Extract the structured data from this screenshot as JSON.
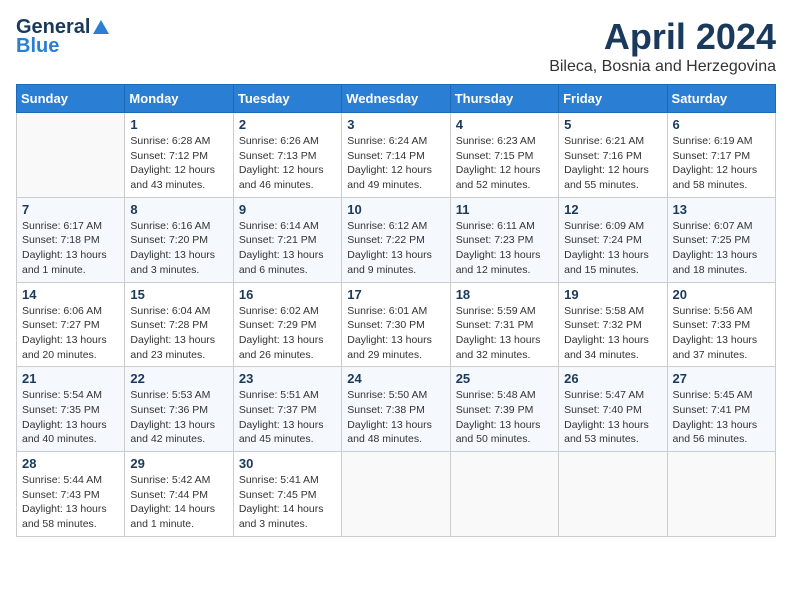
{
  "logo": {
    "general": "General",
    "blue": "Blue"
  },
  "header": {
    "month": "April 2024",
    "location": "Bileca, Bosnia and Herzegovina"
  },
  "days_of_week": [
    "Sunday",
    "Monday",
    "Tuesday",
    "Wednesday",
    "Thursday",
    "Friday",
    "Saturday"
  ],
  "weeks": [
    [
      {
        "day": "",
        "sunrise": "",
        "sunset": "",
        "daylight": ""
      },
      {
        "day": "1",
        "sunrise": "Sunrise: 6:28 AM",
        "sunset": "Sunset: 7:12 PM",
        "daylight": "Daylight: 12 hours and 43 minutes."
      },
      {
        "day": "2",
        "sunrise": "Sunrise: 6:26 AM",
        "sunset": "Sunset: 7:13 PM",
        "daylight": "Daylight: 12 hours and 46 minutes."
      },
      {
        "day": "3",
        "sunrise": "Sunrise: 6:24 AM",
        "sunset": "Sunset: 7:14 PM",
        "daylight": "Daylight: 12 hours and 49 minutes."
      },
      {
        "day": "4",
        "sunrise": "Sunrise: 6:23 AM",
        "sunset": "Sunset: 7:15 PM",
        "daylight": "Daylight: 12 hours and 52 minutes."
      },
      {
        "day": "5",
        "sunrise": "Sunrise: 6:21 AM",
        "sunset": "Sunset: 7:16 PM",
        "daylight": "Daylight: 12 hours and 55 minutes."
      },
      {
        "day": "6",
        "sunrise": "Sunrise: 6:19 AM",
        "sunset": "Sunset: 7:17 PM",
        "daylight": "Daylight: 12 hours and 58 minutes."
      }
    ],
    [
      {
        "day": "7",
        "sunrise": "Sunrise: 6:17 AM",
        "sunset": "Sunset: 7:18 PM",
        "daylight": "Daylight: 13 hours and 1 minute."
      },
      {
        "day": "8",
        "sunrise": "Sunrise: 6:16 AM",
        "sunset": "Sunset: 7:20 PM",
        "daylight": "Daylight: 13 hours and 3 minutes."
      },
      {
        "day": "9",
        "sunrise": "Sunrise: 6:14 AM",
        "sunset": "Sunset: 7:21 PM",
        "daylight": "Daylight: 13 hours and 6 minutes."
      },
      {
        "day": "10",
        "sunrise": "Sunrise: 6:12 AM",
        "sunset": "Sunset: 7:22 PM",
        "daylight": "Daylight: 13 hours and 9 minutes."
      },
      {
        "day": "11",
        "sunrise": "Sunrise: 6:11 AM",
        "sunset": "Sunset: 7:23 PM",
        "daylight": "Daylight: 13 hours and 12 minutes."
      },
      {
        "day": "12",
        "sunrise": "Sunrise: 6:09 AM",
        "sunset": "Sunset: 7:24 PM",
        "daylight": "Daylight: 13 hours and 15 minutes."
      },
      {
        "day": "13",
        "sunrise": "Sunrise: 6:07 AM",
        "sunset": "Sunset: 7:25 PM",
        "daylight": "Daylight: 13 hours and 18 minutes."
      }
    ],
    [
      {
        "day": "14",
        "sunrise": "Sunrise: 6:06 AM",
        "sunset": "Sunset: 7:27 PM",
        "daylight": "Daylight: 13 hours and 20 minutes."
      },
      {
        "day": "15",
        "sunrise": "Sunrise: 6:04 AM",
        "sunset": "Sunset: 7:28 PM",
        "daylight": "Daylight: 13 hours and 23 minutes."
      },
      {
        "day": "16",
        "sunrise": "Sunrise: 6:02 AM",
        "sunset": "Sunset: 7:29 PM",
        "daylight": "Daylight: 13 hours and 26 minutes."
      },
      {
        "day": "17",
        "sunrise": "Sunrise: 6:01 AM",
        "sunset": "Sunset: 7:30 PM",
        "daylight": "Daylight: 13 hours and 29 minutes."
      },
      {
        "day": "18",
        "sunrise": "Sunrise: 5:59 AM",
        "sunset": "Sunset: 7:31 PM",
        "daylight": "Daylight: 13 hours and 32 minutes."
      },
      {
        "day": "19",
        "sunrise": "Sunrise: 5:58 AM",
        "sunset": "Sunset: 7:32 PM",
        "daylight": "Daylight: 13 hours and 34 minutes."
      },
      {
        "day": "20",
        "sunrise": "Sunrise: 5:56 AM",
        "sunset": "Sunset: 7:33 PM",
        "daylight": "Daylight: 13 hours and 37 minutes."
      }
    ],
    [
      {
        "day": "21",
        "sunrise": "Sunrise: 5:54 AM",
        "sunset": "Sunset: 7:35 PM",
        "daylight": "Daylight: 13 hours and 40 minutes."
      },
      {
        "day": "22",
        "sunrise": "Sunrise: 5:53 AM",
        "sunset": "Sunset: 7:36 PM",
        "daylight": "Daylight: 13 hours and 42 minutes."
      },
      {
        "day": "23",
        "sunrise": "Sunrise: 5:51 AM",
        "sunset": "Sunset: 7:37 PM",
        "daylight": "Daylight: 13 hours and 45 minutes."
      },
      {
        "day": "24",
        "sunrise": "Sunrise: 5:50 AM",
        "sunset": "Sunset: 7:38 PM",
        "daylight": "Daylight: 13 hours and 48 minutes."
      },
      {
        "day": "25",
        "sunrise": "Sunrise: 5:48 AM",
        "sunset": "Sunset: 7:39 PM",
        "daylight": "Daylight: 13 hours and 50 minutes."
      },
      {
        "day": "26",
        "sunrise": "Sunrise: 5:47 AM",
        "sunset": "Sunset: 7:40 PM",
        "daylight": "Daylight: 13 hours and 53 minutes."
      },
      {
        "day": "27",
        "sunrise": "Sunrise: 5:45 AM",
        "sunset": "Sunset: 7:41 PM",
        "daylight": "Daylight: 13 hours and 56 minutes."
      }
    ],
    [
      {
        "day": "28",
        "sunrise": "Sunrise: 5:44 AM",
        "sunset": "Sunset: 7:43 PM",
        "daylight": "Daylight: 13 hours and 58 minutes."
      },
      {
        "day": "29",
        "sunrise": "Sunrise: 5:42 AM",
        "sunset": "Sunset: 7:44 PM",
        "daylight": "Daylight: 14 hours and 1 minute."
      },
      {
        "day": "30",
        "sunrise": "Sunrise: 5:41 AM",
        "sunset": "Sunset: 7:45 PM",
        "daylight": "Daylight: 14 hours and 3 minutes."
      },
      {
        "day": "",
        "sunrise": "",
        "sunset": "",
        "daylight": ""
      },
      {
        "day": "",
        "sunrise": "",
        "sunset": "",
        "daylight": ""
      },
      {
        "day": "",
        "sunrise": "",
        "sunset": "",
        "daylight": ""
      },
      {
        "day": "",
        "sunrise": "",
        "sunset": "",
        "daylight": ""
      }
    ]
  ]
}
